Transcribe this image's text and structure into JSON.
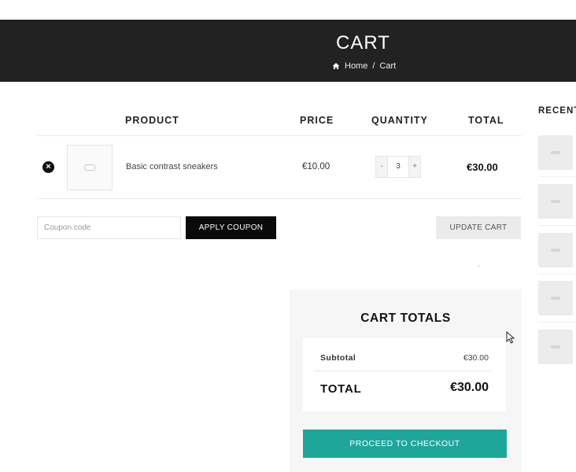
{
  "header": {
    "title": "CART",
    "breadcrumb": {
      "home": "Home",
      "separator": "/",
      "current": "Cart"
    }
  },
  "table": {
    "headers": {
      "product": "PRODUCT",
      "price": "PRICE",
      "quantity": "QUANTITY",
      "total": "TOTAL"
    },
    "rows": [
      {
        "remove": "×",
        "name": "Basic contrast sneakers",
        "price": "€10.00",
        "quantity": "3",
        "minus": "-",
        "plus": "+",
        "total": "€30.00"
      }
    ]
  },
  "coupon": {
    "placeholder": "Coupon code",
    "apply_label": "APPLY COUPON"
  },
  "update_label": "UPDATE CART",
  "totals": {
    "title": "CART TOTALS",
    "subtotal_label": "Subtotal",
    "subtotal_value": "€30.00",
    "total_label": "TOTAL",
    "total_value": "€30.00",
    "checkout_label": "PROCEED TO CHECKOUT"
  },
  "sidebar": {
    "title": "RECENT"
  },
  "colors": {
    "header_bg": "#222222",
    "checkout": "#1fa69b",
    "apply": "#0a0a0a"
  }
}
